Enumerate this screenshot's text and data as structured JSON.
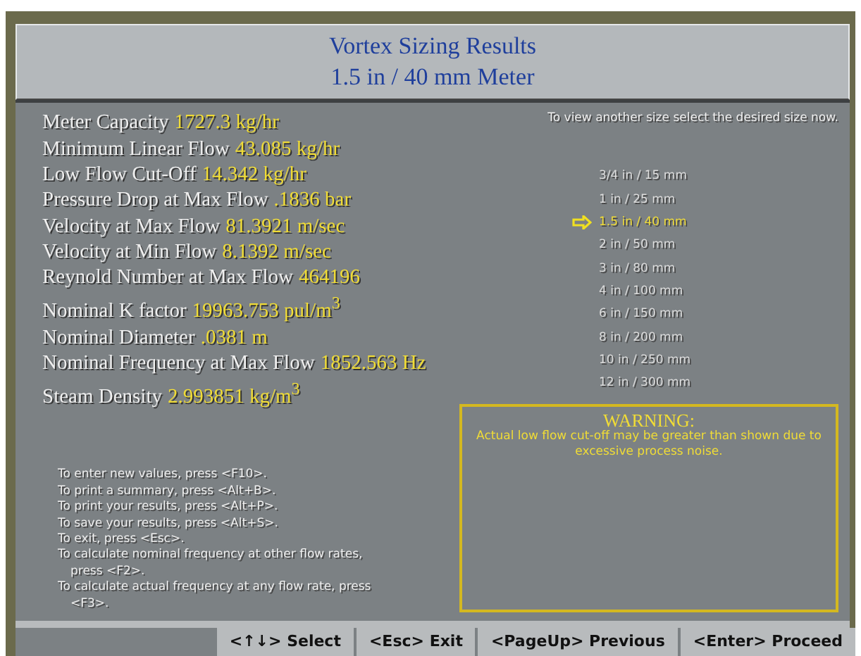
{
  "title": "Vortex Sizing Results",
  "subtitle": "1.5 in / 40 mm Meter",
  "results": [
    {
      "label": "Meter Capacity",
      "value": "1727.3 kg/hr"
    },
    {
      "label": "Minimum Linear Flow",
      "value": "43.085 kg/hr"
    },
    {
      "label": "Low Flow Cut-Off",
      "value": "14.342 kg/hr"
    },
    {
      "label": "Pressure Drop at Max Flow",
      "value": ".1836 bar"
    },
    {
      "label": "Velocity at Max Flow",
      "value": "81.3921 m/sec"
    },
    {
      "label": "Velocity at Min Flow",
      "value": "8.1392 m/sec"
    },
    {
      "label": "Reynold Number at Max Flow",
      "value": "464196"
    },
    {
      "label": "Nominal K factor",
      "value": "19963.753 pul/m$^{3}$"
    },
    {
      "label": "Nominal Diameter",
      "value": ".0381 m"
    },
    {
      "label": "Nominal Frequency at Max Flow",
      "value": "1852.563 Hz"
    },
    {
      "label": "Steam Density",
      "value": "2.993851 kg/m$^{3}$"
    }
  ],
  "size_hint": "To view another size select the desired size now.",
  "sizes": [
    {
      "label": "3/4 in / 15 mm",
      "selected": false
    },
    {
      "label": "1 in / 25 mm",
      "selected": false
    },
    {
      "label": "1.5 in / 40 mm",
      "selected": true
    },
    {
      "label": "2 in / 50 mm",
      "selected": false
    },
    {
      "label": "3 in / 80 mm",
      "selected": false
    },
    {
      "label": "4 in / 100 mm",
      "selected": false
    },
    {
      "label": "6 in / 150 mm",
      "selected": false
    },
    {
      "label": "8 in / 200 mm",
      "selected": false
    },
    {
      "label": "10 in / 250 mm",
      "selected": false
    },
    {
      "label": "12 in / 300 mm",
      "selected": false
    }
  ],
  "instructions": [
    "To enter new values, press <F10>.",
    "To print a summary, press <Alt+B>.",
    "To print your results, press <Alt+P>.",
    "To save your results, press <Alt+S>.",
    "To exit, press <Esc>.",
    "To calculate nominal frequency at other flow rates, press <F2>.",
    "To calculate actual frequency at any flow rate, press <F3>."
  ],
  "warning": {
    "title": "WARNING:",
    "text": "Actual low flow cut-off may be greater than shown due to excessive process noise."
  },
  "keys": [
    "<↑↓> Select",
    "<Esc> Exit",
    "<PageUp> Previous",
    "<Enter> Proceed"
  ]
}
